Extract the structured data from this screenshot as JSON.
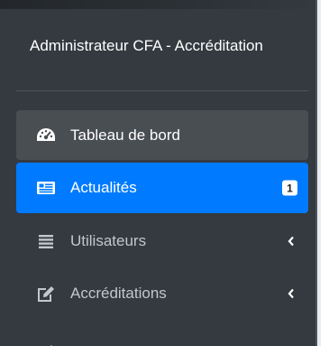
{
  "sidebar": {
    "brand": "Administrateur CFA - Accréditation",
    "items": [
      {
        "label": "Tableau de bord",
        "icon": "tachometer-icon",
        "state": "hover"
      },
      {
        "label": "Actualités",
        "icon": "newspaper-icon",
        "state": "active",
        "badge": "1"
      },
      {
        "label": "Utilisateurs",
        "icon": "list-icon",
        "state": "normal",
        "has_submenu": true
      },
      {
        "label": "Accréditations",
        "icon": "edit-icon",
        "state": "normal",
        "has_submenu": true
      },
      {
        "label": "",
        "icon": "edit-icon",
        "state": "normal",
        "partial": true
      }
    ]
  },
  "colors": {
    "sidebar_bg": "#343a40",
    "active_bg": "#007bff",
    "hover_bg": "#494e53",
    "text_muted": "#c2c7d0",
    "text_active": "#ffffff"
  }
}
